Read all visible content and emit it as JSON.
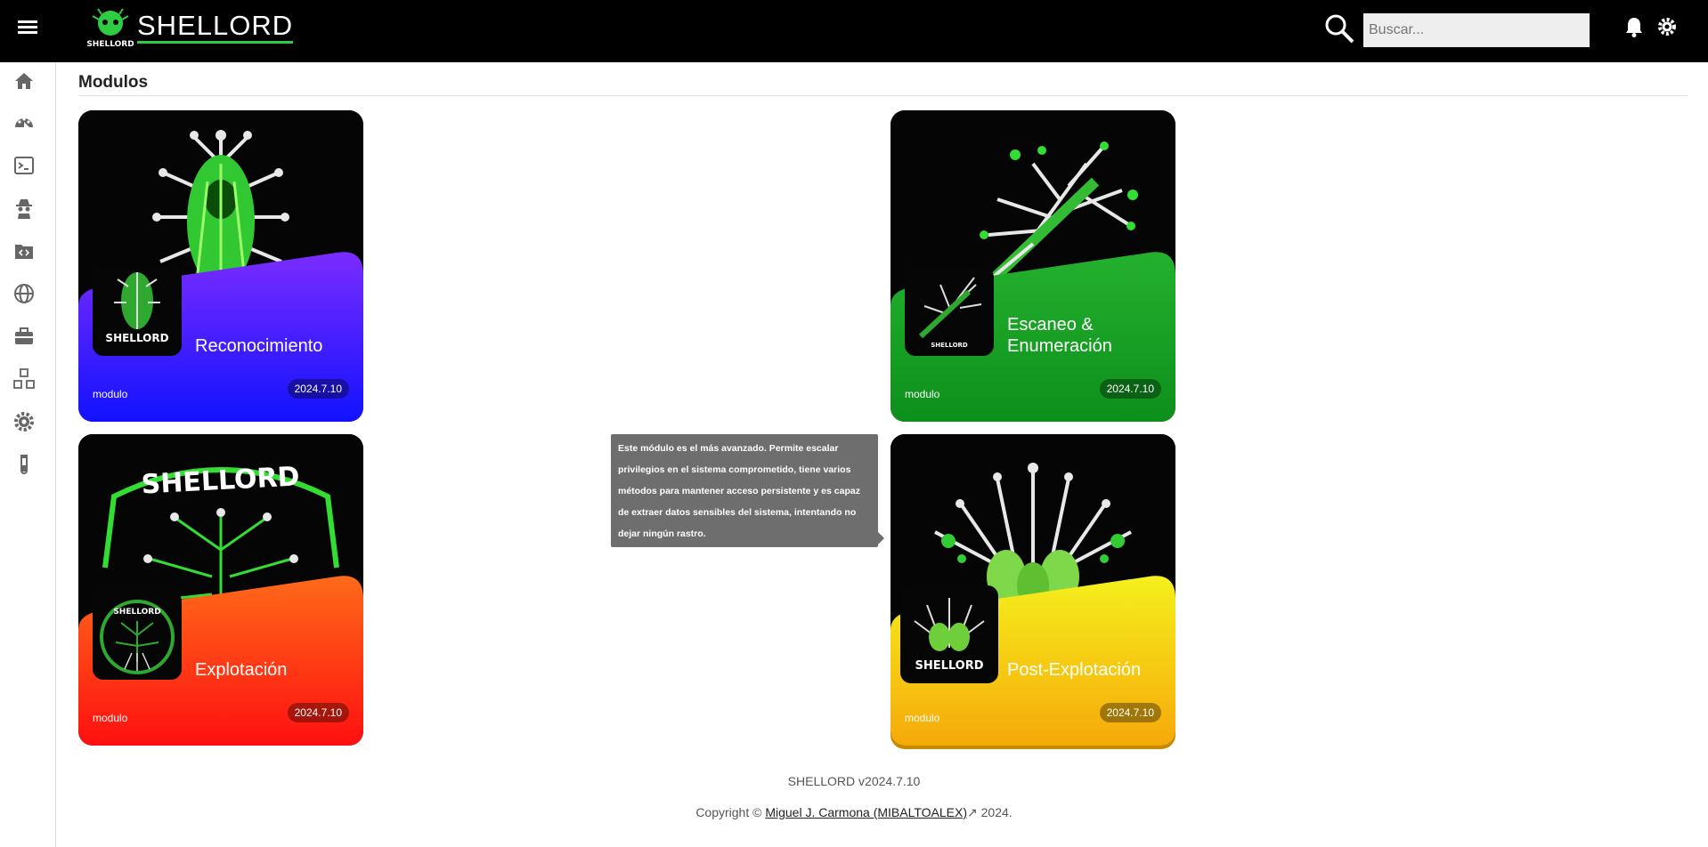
{
  "header": {
    "brand": "SHELLORD",
    "search_placeholder": "Buscar..."
  },
  "sidebar": {
    "items": [
      {
        "icon": "home-icon"
      },
      {
        "icon": "dashboard-icon"
      },
      {
        "icon": "terminal-icon"
      },
      {
        "icon": "spy-icon"
      },
      {
        "icon": "code-folder-icon"
      },
      {
        "icon": "globe-icon"
      },
      {
        "icon": "toolbox-icon"
      },
      {
        "icon": "modules-icon"
      },
      {
        "icon": "gear-icon"
      },
      {
        "icon": "flask-icon"
      }
    ]
  },
  "page": {
    "title": "Modulos"
  },
  "cards": [
    {
      "name": "Reconocimiento",
      "tag": "modulo",
      "version": "2024.7.10",
      "color_top": "#7b2cff",
      "color_bottom": "#1212ff"
    },
    {
      "name_line1": "Escaneo &",
      "name_line2": "Enumeración",
      "tag": "modulo",
      "version": "2024.7.10",
      "color_top": "#24b12e",
      "color_bottom": "#0d8f1c"
    },
    {
      "name": "Explotación",
      "tag": "modulo",
      "version": "2024.7.10",
      "color_top": "#ff6a1a",
      "color_bottom": "#ff1010"
    },
    {
      "name": "Post-Explotación",
      "tag": "modulo",
      "version": "2024.7.10",
      "color_top": "#f5f01c",
      "color_bottom": "#f6a90a"
    }
  ],
  "tooltip": {
    "text": "Este módulo es el más avanzado. Permite escalar privilegios en el sistema comprometido, tiene varios métodos para mantener acceso persistente y es capaz de extraer datos sensibles del sistema, intentando no dejar ningún rastro."
  },
  "footer": {
    "version": "SHELLORD v2024.7.10",
    "copyright_prefix": "Copyright ©",
    "author_link": "Miguel J. Carmona (MIBALTOALEX)",
    "year": "2024."
  }
}
